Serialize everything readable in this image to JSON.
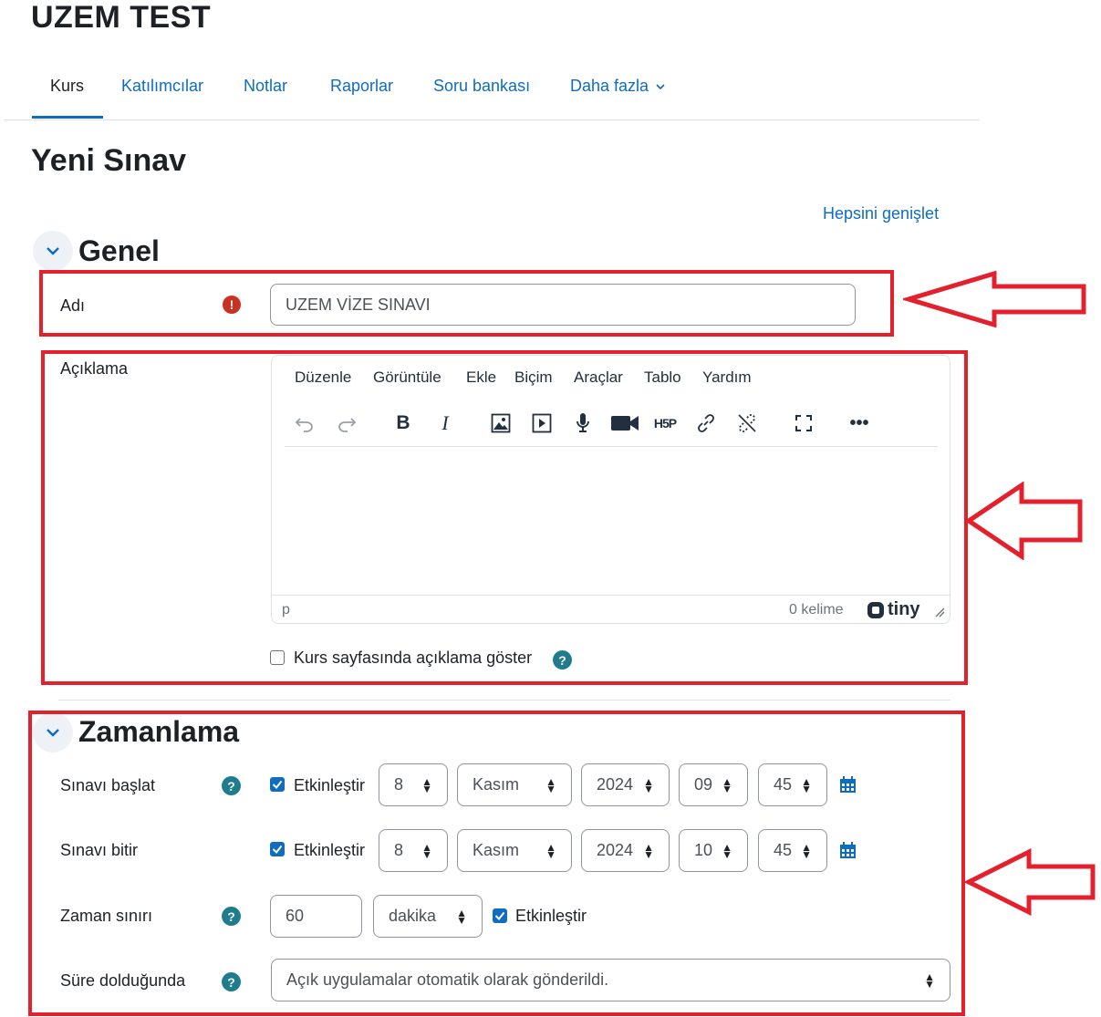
{
  "course": {
    "title": "UZEM TEST"
  },
  "nav": {
    "items": [
      "Kurs",
      "Katılımcılar",
      "Notlar",
      "Raporlar",
      "Soru bankası",
      "Daha fazla"
    ],
    "active": "Kurs"
  },
  "page": {
    "title": "Yeni Sınav",
    "expand_all": "Hepsini genişlet"
  },
  "general": {
    "title": "Genel",
    "name_label": "Adı",
    "name_value": "UZEM VİZE SINAVI",
    "description_label": "Açıklama",
    "editor": {
      "menu": [
        "Düzenle",
        "Görüntüle",
        "Ekle",
        "Biçim",
        "Araçlar",
        "Tablo",
        "Yardım"
      ],
      "path": "p",
      "word_count": "0 kelime",
      "brand": "tiny"
    },
    "show_description_label": "Kurs sayfasında açıklama göster",
    "show_description_checked": false
  },
  "timing": {
    "title": "Zamanlama",
    "enable_label": "Etkinleştir",
    "open": {
      "label": "Sınavı başlat",
      "enabled": true,
      "day": "8",
      "month": "Kasım",
      "year": "2024",
      "hour": "09",
      "minute": "45"
    },
    "close": {
      "label": "Sınavı bitir",
      "enabled": true,
      "day": "8",
      "month": "Kasım",
      "year": "2024",
      "hour": "10",
      "minute": "45"
    },
    "limit": {
      "label": "Zaman sınırı",
      "value": "60",
      "unit": "dakika",
      "enabled": true
    },
    "overdue": {
      "label": "Süre dolduğunda",
      "value": "Açık uygulamalar otomatik olarak gönderildi."
    }
  },
  "colors": {
    "link": "#0f6cbf",
    "annotation": "#e3202b",
    "help": "#1f7c8c",
    "required": "#ca3120"
  }
}
